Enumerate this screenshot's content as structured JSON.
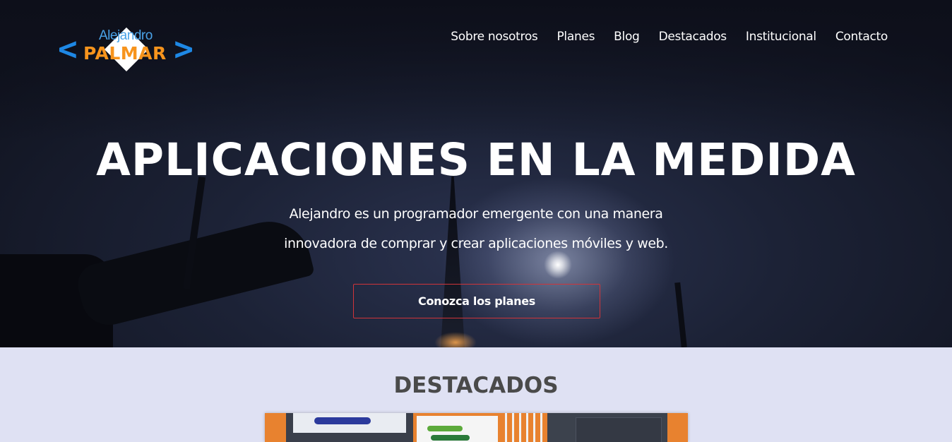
{
  "logo": {
    "top_text": "Alejandro",
    "main_text": "PALMAR"
  },
  "nav": {
    "items": [
      "Sobre nosotros",
      "Planes",
      "Blog",
      "Destacados",
      "Institucional",
      "Contacto"
    ]
  },
  "hero": {
    "title": "APLICACIONES EN LA MEDIDA",
    "subtitle": "Alejandro es un programador emergente con una manera innovadora de comprar y crear aplicaciones móviles y web.",
    "cta_label": "Conozca los planes"
  },
  "featured": {
    "title": "DESTACADOS"
  },
  "colors": {
    "logo_blue": "#1e88e5",
    "logo_orange": "#f7941d",
    "cta_border": "#d0343a",
    "section_bg": "#dfe1f3",
    "section_title": "#4a4a4a"
  }
}
